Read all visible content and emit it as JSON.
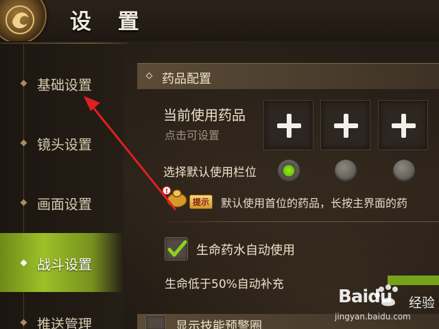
{
  "header": {
    "title": "设 置",
    "emblem_icon": "dragon-emblem-icon"
  },
  "sidebar": {
    "items": [
      {
        "label": "基础设置",
        "active": false
      },
      {
        "label": "镜头设置",
        "active": false
      },
      {
        "label": "画面设置",
        "active": false
      },
      {
        "label": "战斗设置",
        "active": true
      },
      {
        "label": "推送管理",
        "active": false
      }
    ]
  },
  "main": {
    "section_title": "药品配置",
    "current_medicine_label": "当前使用药品",
    "click_to_set": "点击可设置",
    "slots": [
      {
        "icon": "plus-icon"
      },
      {
        "icon": "plus-icon"
      },
      {
        "icon": "plus-icon"
      }
    ],
    "default_slot_label": "选择默认使用栏位",
    "default_slot_selected": 0,
    "tip_badge": "提示",
    "tip_text": "默认使用首位的药品，长按主界面的药",
    "auto_use_label": "生命药水自动使用",
    "auto_use_checked": true,
    "hp_threshold_label": "生命低于50%自动补充",
    "next_section_label": "显示技能预警圈"
  },
  "watermark": {
    "brand": "Baidu",
    "cn": "经验",
    "url": "jingyan.baidu.com"
  },
  "colors": {
    "accent_green": "#9cc028",
    "annotation_red": "#e02020"
  }
}
